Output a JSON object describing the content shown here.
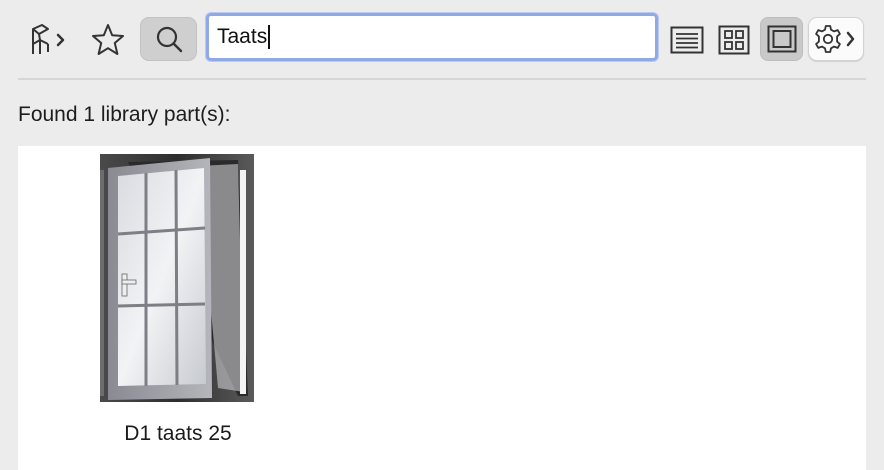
{
  "toolbar": {
    "library_settings_icon": "chair-chevron-icon",
    "favorites_icon": "star-icon",
    "search_icon": "magnifier-icon",
    "search_value": "Taats",
    "list_view_icon": "list-icon",
    "grid_view_icon": "grid-icon",
    "preview_view_icon": "single-preview-icon",
    "options_icon": "gear-chevron-icon"
  },
  "status": {
    "text": "Found 1 library part(s):"
  },
  "results": [
    {
      "label": "D1 taats 25",
      "icon": "door-thumbnail"
    }
  ],
  "colors": {
    "background": "#ececec",
    "search_focus_ring": "#8fa9e6",
    "active_button": "#cfcfcf",
    "panel": "#ffffff"
  }
}
